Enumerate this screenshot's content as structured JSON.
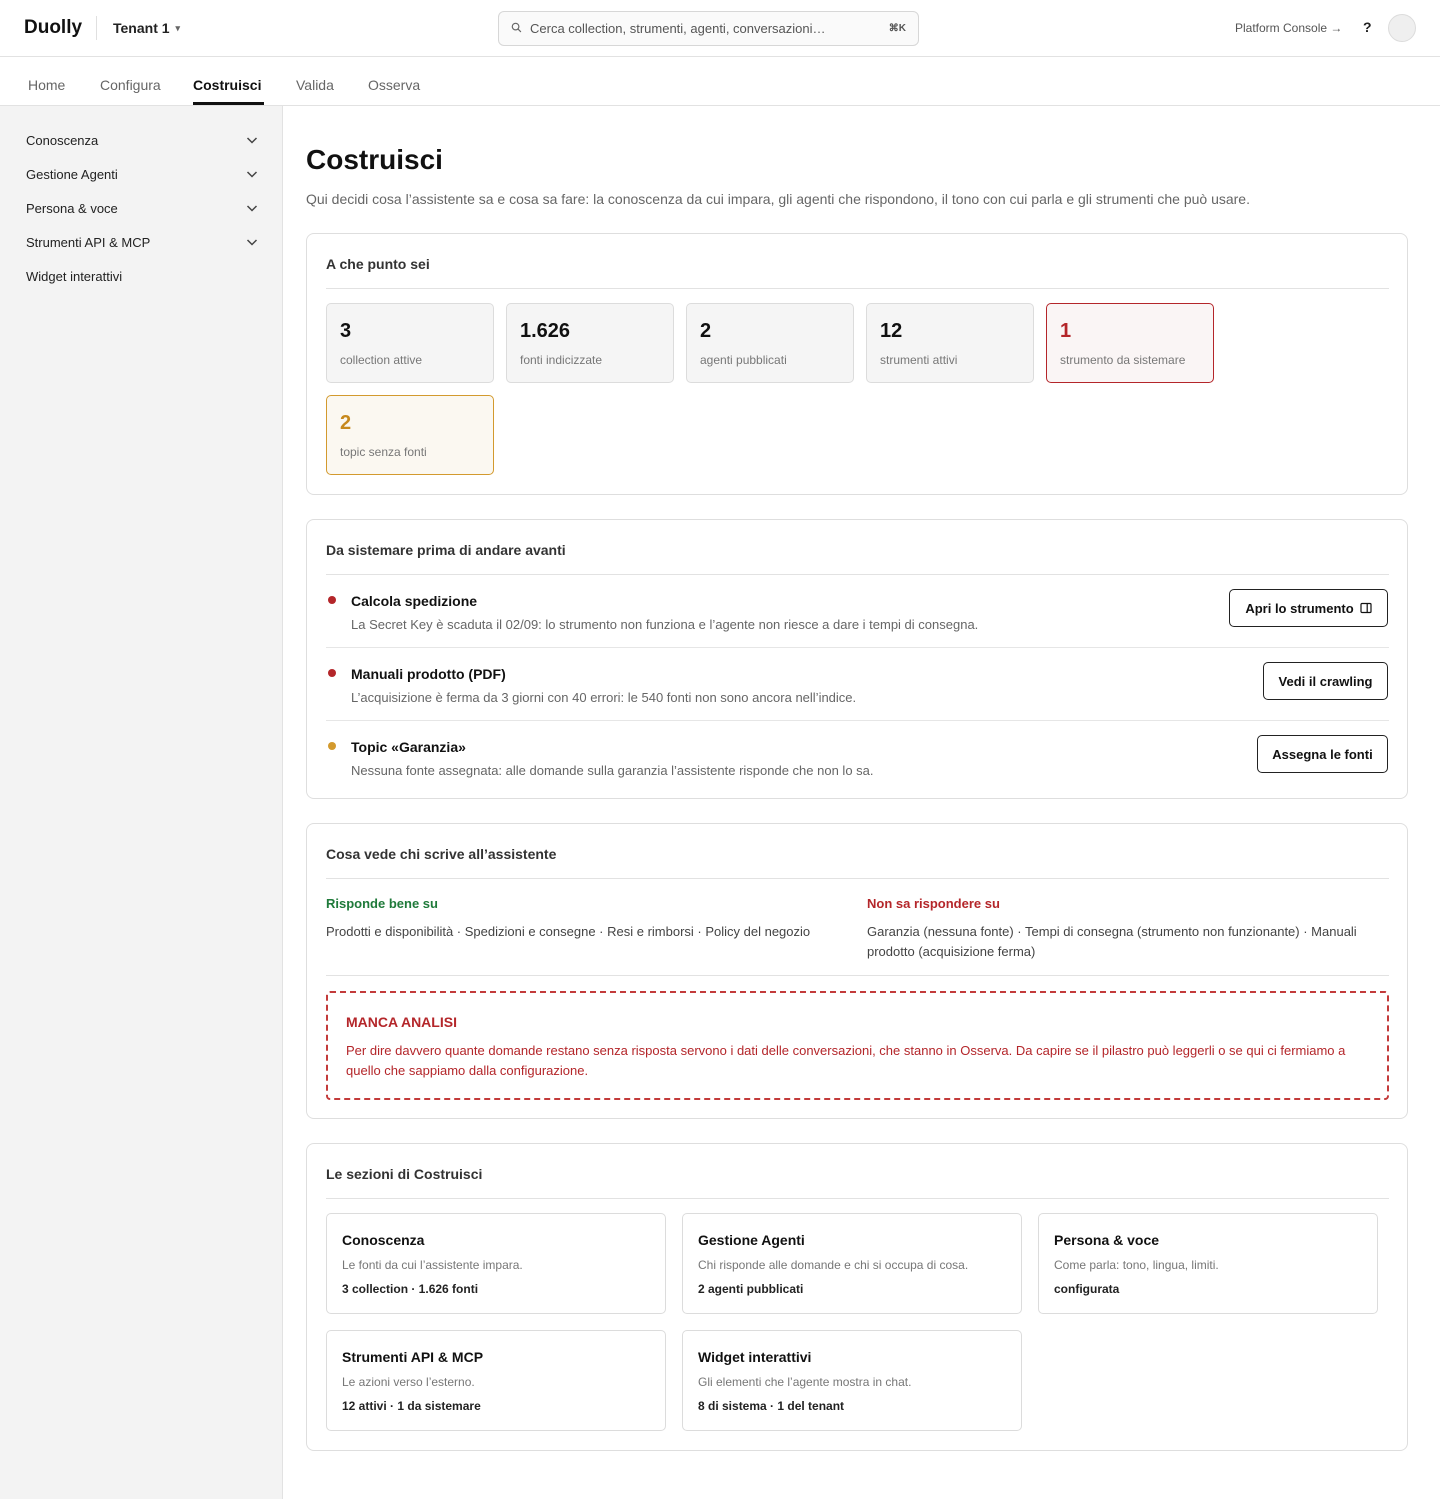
{
  "header": {
    "brand": "Duolly",
    "tenant": "Tenant 1",
    "search_placeholder": "Cerca collection, strumenti, agenti, conversazioni…",
    "search_shortcut": "⌘K",
    "platform_console": "Platform Console →",
    "help": "?"
  },
  "tabs": [
    "Home",
    "Configura",
    "Costruisci",
    "Valida",
    "Osserva"
  ],
  "active_tab": "Costruisci",
  "sidebar": {
    "items": [
      {
        "label": "Conoscenza",
        "expandable": true
      },
      {
        "label": "Gestione Agenti",
        "expandable": true
      },
      {
        "label": "Persona & voce",
        "expandable": true
      },
      {
        "label": "Strumenti API & MCP",
        "expandable": true
      },
      {
        "label": "Widget interattivi",
        "expandable": false
      }
    ]
  },
  "page": {
    "title": "Costruisci",
    "subtitle": "Qui decidi cosa l’assistente sa e cosa sa fare: la conoscenza da cui impara, gli agenti che rispondono, il tono con cui parla e gli strumenti che può usare."
  },
  "status": {
    "title": "A che punto sei",
    "stats": [
      {
        "value": "3",
        "label": "collection attive",
        "tone": "neutral"
      },
      {
        "value": "1.626",
        "label": "fonti indicizzate",
        "tone": "neutral"
      },
      {
        "value": "2",
        "label": "agenti pubblicati",
        "tone": "neutral"
      },
      {
        "value": "12",
        "label": "strumenti attivi",
        "tone": "neutral"
      },
      {
        "value": "1",
        "label": "strumento da sistemare",
        "tone": "red"
      },
      {
        "value": "2",
        "label": "topic senza fonti",
        "tone": "amber"
      }
    ]
  },
  "issues": {
    "title": "Da sistemare prima di andare avanti",
    "items": [
      {
        "title": "Calcola spedizione",
        "desc": "La Secret Key è scaduta il 02/09: lo strumento non funziona e l’agente non riesce a dare i tempi di consegna.",
        "action": "Apri lo strumento",
        "severity": "red"
      },
      {
        "title": "Manuali prodotto (PDF)",
        "desc": "L’acquisizione è ferma da 3 giorni con 40 errori: le 540 fonti non sono ancora nell’indice.",
        "action": "Vedi il crawling",
        "severity": "red"
      },
      {
        "title": "Topic «Garanzia»",
        "desc": "Nessuna fonte assegnata: alle domande sulla garanzia l’assistente risponde che non lo sa.",
        "action": "Assegna le fonti",
        "severity": "amber"
      }
    ]
  },
  "coverage": {
    "title": "Cosa vede chi scrive all’assistente",
    "good_head": "Risponde bene su",
    "good_text": "Prodotti e disponibilità · Spedizioni e consegne · Resi e rimborsi · Policy del negozio",
    "bad_head": "Non sa rispondere su",
    "bad_text": "Garanzia (nessuna fonte) · Tempi di consegna (strumento non funzionante) · Manuali prodotto (acquisizione ferma)",
    "missing_title": "MANCA ANALISI",
    "missing_text": "Per dire davvero quante domande restano senza risposta servono i dati delle conversazioni, che stanno in Osserva. Da capire se il pilastro può leggerli o se qui ci fermiamo a quello che sappiamo dalla configurazione."
  },
  "sections": {
    "title": "Le sezioni di Costruisci",
    "items": [
      {
        "title": "Conoscenza",
        "desc": "Le fonti da cui l’assistente impara.",
        "meta": "3 collection · 1.626 fonti"
      },
      {
        "title": "Gestione Agenti",
        "desc": "Chi risponde alle domande e chi si occupa di cosa.",
        "meta": "2 agenti pubblicati"
      },
      {
        "title": "Persona & voce",
        "desc": "Come parla: tono, lingua, limiti.",
        "meta": "configurata"
      },
      {
        "title": "Strumenti API & MCP",
        "desc": "Le azioni verso l’esterno.",
        "meta": "12 attivi · 1 da sistemare"
      },
      {
        "title": "Widget interattivi",
        "desc": "Gli elementi che l’agente mostra in chat.",
        "meta": "8 di sistema · 1 del tenant"
      }
    ]
  },
  "colors": {
    "red": "#b4262a",
    "amber": "#d39a2e",
    "green": "#1f7a3a"
  }
}
